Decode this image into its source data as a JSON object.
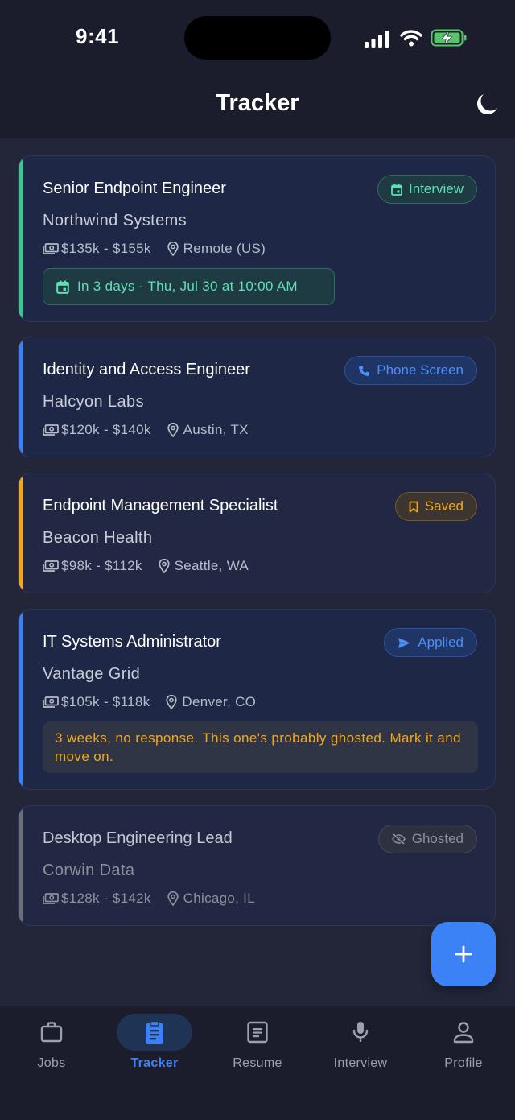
{
  "status_bar": {
    "time": "9:41"
  },
  "header": {
    "title": "Tracker"
  },
  "colors": {
    "accent_blue": "#3b82f6",
    "interview_green": "#5ee0b3",
    "saved_amber": "#f0a81c",
    "ghosted_gray": "#8d919c"
  },
  "cards": [
    {
      "title": "Senior Endpoint Engineer",
      "company": "Northwind Systems",
      "salary": "$135k - $155k",
      "location": "Remote (US)",
      "status": "Interview",
      "status_icon": "calendar-icon",
      "interview_note": "In 3 days - Thu, Jul 30 at 10:00 AM"
    },
    {
      "title": "Identity and Access Engineer",
      "company": "Halcyon Labs",
      "salary": "$120k - $140k",
      "location": "Austin, TX",
      "status": "Phone Screen",
      "status_icon": "phone-icon"
    },
    {
      "title": "Endpoint Management Specialist",
      "company": "Beacon Health",
      "salary": "$98k - $112k",
      "location": "Seattle, WA",
      "status": "Saved",
      "status_icon": "bookmark-icon"
    },
    {
      "title": "IT Systems Administrator",
      "company": "Vantage Grid",
      "salary": "$105k - $118k",
      "location": "Denver, CO",
      "status": "Applied",
      "status_icon": "send-icon",
      "warning_note": "3 weeks, no response. This one's probably ghosted. Mark it and move on."
    },
    {
      "title": "Desktop Engineering Lead",
      "company": "Corwin Data",
      "salary": "$128k - $142k",
      "location": "Chicago, IL",
      "status": "Ghosted",
      "status_icon": "eye-off-icon"
    }
  ],
  "nav": {
    "items": [
      {
        "label": "Jobs",
        "icon": "briefcase-icon",
        "active": false
      },
      {
        "label": "Tracker",
        "icon": "clipboard-icon",
        "active": true
      },
      {
        "label": "Resume",
        "icon": "document-icon",
        "active": false
      },
      {
        "label": "Interview",
        "icon": "microphone-icon",
        "active": false
      },
      {
        "label": "Profile",
        "icon": "person-icon",
        "active": false
      }
    ]
  }
}
